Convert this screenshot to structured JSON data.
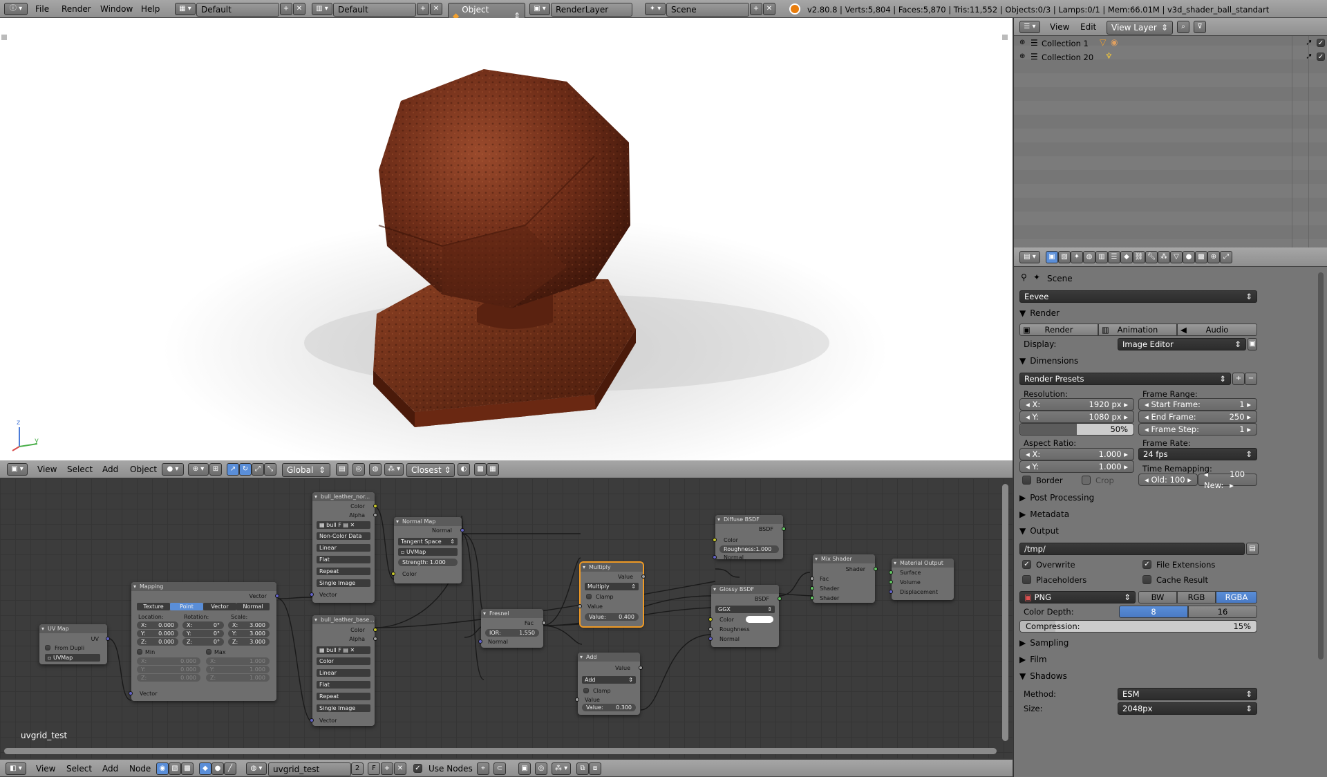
{
  "topbar": {
    "menus": [
      "File",
      "Render",
      "Window",
      "Help"
    ],
    "workspace": "Default",
    "screen_layout": "Default",
    "mode": "Object Mode",
    "render_layer": "RenderLayer",
    "scene": "Scene",
    "stats": "v2.80.8 | Verts:5,804 | Faces:5,870 | Tris:11,552 | Objects:0/3 | Lamps:0/1 | Mem:66.01M | v3d_shader_ball_standart"
  },
  "viewport": {
    "axis_z": "z",
    "axis_y": "y",
    "menus": [
      "View",
      "Select",
      "Add",
      "Object"
    ],
    "orientation": "Global",
    "snap": "Closest"
  },
  "outliner": {
    "menus": [
      "View",
      "Edit"
    ],
    "view_layer": "View Layer",
    "collections": [
      "Collection 1",
      "Collection 20"
    ]
  },
  "properties": {
    "context": "Scene",
    "engine": "Eevee",
    "render": {
      "title": "Render",
      "buttons": [
        "Render",
        "Animation",
        "Audio"
      ],
      "display_label": "Display:",
      "display_value": "Image Editor"
    },
    "dimensions": {
      "title": "Dimensions",
      "presets": "Render Presets",
      "resolution_label": "Resolution:",
      "res_x_label": "X:",
      "res_x": "1920 px",
      "res_y_label": "Y:",
      "res_y": "1080 px",
      "res_pct": "50%",
      "res_pct_value": 0.5,
      "frame_range_label": "Frame Range:",
      "start_label": "Start Frame:",
      "start": "1",
      "end_label": "End Frame:",
      "end": "250",
      "step_label": "Frame Step:",
      "step": "1",
      "aspect_label": "Aspect Ratio:",
      "asp_x_label": "X:",
      "asp_x": "1.000",
      "asp_y_label": "Y:",
      "asp_y": "1.000",
      "frame_rate_label": "Frame Rate:",
      "frame_rate": "24 fps",
      "time_remap_label": "Time Remapping:",
      "old_label": "Old:",
      "old": "100",
      "new_label": "New:",
      "new": "100",
      "border": "Border",
      "crop": "Crop"
    },
    "post_processing": "Post Processing",
    "metadata": "Metadata",
    "output": {
      "title": "Output",
      "path": "/tmp/",
      "overwrite": "Overwrite",
      "file_extensions": "File Extensions",
      "placeholders": "Placeholders",
      "cache_result": "Cache Result",
      "format": "PNG",
      "color_modes": [
        "BW",
        "RGB",
        "RGBA"
      ],
      "color_depth_label": "Color Depth:",
      "depths": [
        "8",
        "16"
      ],
      "compression_label": "Compression:",
      "compression": "15%",
      "compression_value": 0.15
    },
    "sampling": "Sampling",
    "film": "Film",
    "shadows": {
      "title": "Shadows",
      "method_label": "Method:",
      "method": "ESM",
      "size_label": "Size:",
      "size": "2048px"
    }
  },
  "node_editor": {
    "material_label": "uvgrid_test",
    "menus": [
      "View",
      "Select",
      "Add",
      "Node"
    ],
    "material": "uvgrid_test",
    "users": "2",
    "fake": "F",
    "use_nodes": "Use Nodes",
    "nodes": {
      "uvmap": {
        "title": "UV Map",
        "out": "UV",
        "from_dupli": "From Dupli",
        "map": "UVMap"
      },
      "mapping": {
        "title": "Mapping",
        "out": "Vector",
        "tabs": [
          "Texture",
          "Point",
          "Vector",
          "Normal"
        ],
        "loc_label": "Location:",
        "rot_label": "Rotation:",
        "scale_label": "Scale:",
        "loc": [
          "0.000",
          "0.000",
          "0.000"
        ],
        "rot": [
          "0°",
          "0°",
          "0°"
        ],
        "scale": [
          "3.000",
          "3.000",
          "3.000"
        ],
        "min": "Min",
        "max": "Max",
        "min_vals": [
          "0.000",
          "0.000",
          "0.000"
        ],
        "max_vals": [
          "1.000",
          "1.000",
          "1.000"
        ],
        "axes": [
          "X:",
          "Y:",
          "Z:"
        ],
        "in": "Vector"
      },
      "tex_nor": {
        "title": "bull_leather_nor...",
        "outs": [
          "Color",
          "Alpha"
        ],
        "img": "bull",
        "f": "F",
        "opts": [
          "Non-Color Data",
          "Linear",
          "Flat",
          "Repeat",
          "Single Image"
        ],
        "in": "Vector"
      },
      "tex_base": {
        "title": "bull_leather_base...",
        "outs": [
          "Color",
          "Alpha"
        ],
        "img": "bull",
        "f": "F",
        "opts": [
          "Color",
          "Linear",
          "Flat",
          "Repeat",
          "Single Image"
        ],
        "in": "Vector"
      },
      "normal_map": {
        "title": "Normal Map",
        "out": "Normal",
        "space": "Tangent Space",
        "uv": "UVMap",
        "strength": "Strength:",
        "strength_val": "1.000",
        "in": "Color"
      },
      "fresnel": {
        "title": "Fresnel",
        "out": "Fac",
        "ior": "IOR:",
        "ior_val": "1.550",
        "in": "Normal"
      },
      "multiply": {
        "title": "Multiply",
        "out": "Value",
        "op": "Multiply",
        "clamp": "Clamp",
        "in": "Value",
        "val_label": "Value:",
        "val": "0.400"
      },
      "add": {
        "title": "Add",
        "out": "Value",
        "op": "Add",
        "clamp": "Clamp",
        "in": "Value",
        "val_label": "Value:",
        "val": "0.300"
      },
      "diffuse": {
        "title": "Diffuse BSDF",
        "out": "BSDF",
        "ins": [
          "Color",
          "Normal"
        ],
        "rough": "Roughness:",
        "rough_val": "1.000"
      },
      "glossy": {
        "title": "Glossy BSDF",
        "out": "BSDF",
        "dist": "GGX",
        "ins": [
          "Color",
          "Roughness",
          "Normal"
        ]
      },
      "mix": {
        "title": "Mix Shader",
        "out": "Shader",
        "ins": [
          "Fac",
          "Shader",
          "Shader"
        ]
      },
      "output": {
        "title": "Material Output",
        "ins": [
          "Surface",
          "Volume",
          "Displacement"
        ]
      }
    }
  }
}
